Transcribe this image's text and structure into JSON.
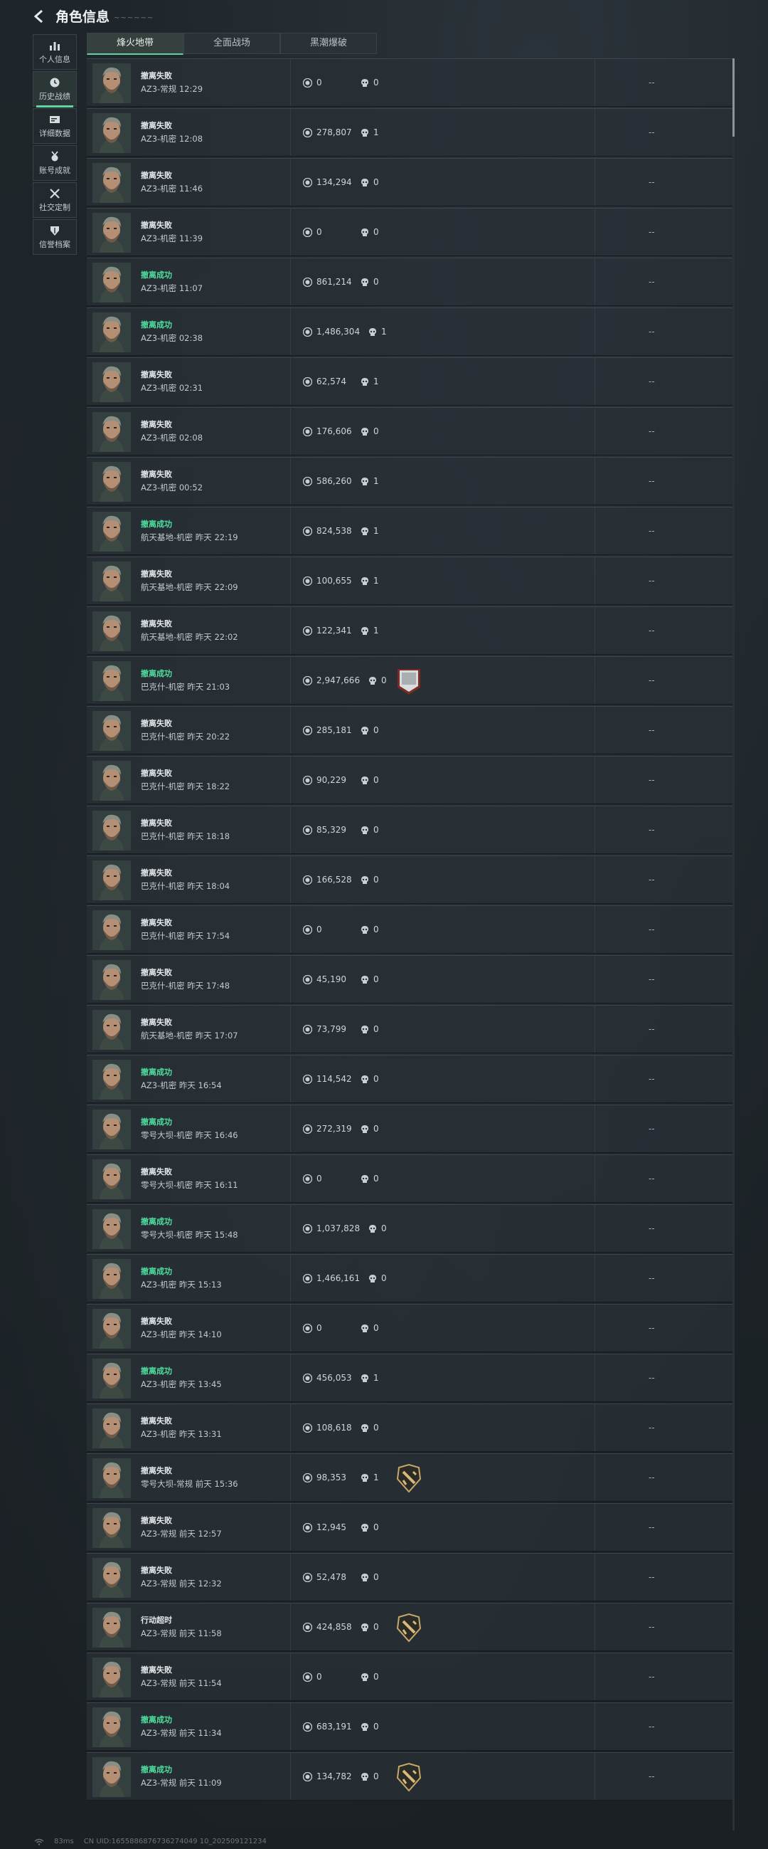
{
  "header": {
    "title": "角色信息",
    "title_deco": "~~~~~~"
  },
  "tabs": [
    {
      "label": "烽火地带",
      "active": true
    },
    {
      "label": "全面战场",
      "active": false
    },
    {
      "label": "黑潮爆破",
      "active": false
    }
  ],
  "sidebar": [
    {
      "label": "个人信息",
      "icon": "bar-chart-icon",
      "active": false,
      "name": "personal-info"
    },
    {
      "label": "历史战绩",
      "icon": "clock-icon",
      "active": true,
      "name": "history-record"
    },
    {
      "label": "详细数据",
      "icon": "data-card-icon",
      "active": false,
      "name": "detail-data"
    },
    {
      "label": "账号成就",
      "icon": "medal-icon",
      "active": false,
      "name": "achievements"
    },
    {
      "label": "社交定制",
      "icon": "tools-icon",
      "active": false,
      "name": "social-custom"
    },
    {
      "label": "信誉档案",
      "icon": "shield-icon",
      "active": false,
      "name": "credit-profile"
    }
  ],
  "colors": {
    "accent": "#5fd3a0",
    "success": "#4fe0a0",
    "row_bg": "#283036"
  },
  "matches": [
    {
      "status": "撤离失败",
      "ok": false,
      "map": "AZ3-常规 12:29",
      "value": "0",
      "kills": "0",
      "badge": "",
      "extra": "--"
    },
    {
      "status": "撤离失败",
      "ok": false,
      "map": "AZ3-机密 12:08",
      "value": "278,807",
      "kills": "1",
      "badge": "",
      "extra": "--"
    },
    {
      "status": "撤离失败",
      "ok": false,
      "map": "AZ3-机密 11:46",
      "value": "134,294",
      "kills": "0",
      "badge": "",
      "extra": "--"
    },
    {
      "status": "撤离失败",
      "ok": false,
      "map": "AZ3-机密 11:39",
      "value": "0",
      "kills": "0",
      "badge": "",
      "extra": "--"
    },
    {
      "status": "撤离成功",
      "ok": true,
      "map": "AZ3-机密 11:07",
      "value": "861,214",
      "kills": "0",
      "badge": "",
      "extra": "--"
    },
    {
      "status": "撤离成功",
      "ok": true,
      "map": "AZ3-机密 02:38",
      "value": "1,486,304",
      "kills": "1",
      "badge": "",
      "extra": "--"
    },
    {
      "status": "撤离失败",
      "ok": false,
      "map": "AZ3-机密 02:31",
      "value": "62,574",
      "kills": "1",
      "badge": "",
      "extra": "--"
    },
    {
      "status": "撤离失败",
      "ok": false,
      "map": "AZ3-机密 02:08",
      "value": "176,606",
      "kills": "0",
      "badge": "",
      "extra": "--"
    },
    {
      "status": "撤离失败",
      "ok": false,
      "map": "AZ3-机密 00:52",
      "value": "586,260",
      "kills": "1",
      "badge": "",
      "extra": "--"
    },
    {
      "status": "撤离成功",
      "ok": true,
      "map": "航天基地-机密 昨天 22:19",
      "value": "824,538",
      "kills": "1",
      "badge": "",
      "extra": "--"
    },
    {
      "status": "撤离失败",
      "ok": false,
      "map": "航天基地-机密 昨天 22:09",
      "value": "100,655",
      "kills": "1",
      "badge": "",
      "extra": "--"
    },
    {
      "status": "撤离失败",
      "ok": false,
      "map": "航天基地-机密 昨天 22:02",
      "value": "122,341",
      "kills": "1",
      "badge": "",
      "extra": "--"
    },
    {
      "status": "撤离成功",
      "ok": true,
      "map": "巴克什-机密 昨天 21:03",
      "value": "2,947,666",
      "kills": "0",
      "badge": "silver-rank-badge",
      "extra": "--"
    },
    {
      "status": "撤离失败",
      "ok": false,
      "map": "巴克什-机密 昨天 20:22",
      "value": "285,181",
      "kills": "0",
      "badge": "",
      "extra": "--"
    },
    {
      "status": "撤离失败",
      "ok": false,
      "map": "巴克什-机密 昨天 18:22",
      "value": "90,229",
      "kills": "0",
      "badge": "",
      "extra": "--"
    },
    {
      "status": "撤离失败",
      "ok": false,
      "map": "巴克什-机密 昨天 18:18",
      "value": "85,329",
      "kills": "0",
      "badge": "",
      "extra": "--"
    },
    {
      "status": "撤离失败",
      "ok": false,
      "map": "巴克什-机密 昨天 18:04",
      "value": "166,528",
      "kills": "0",
      "badge": "",
      "extra": "--"
    },
    {
      "status": "撤离失败",
      "ok": false,
      "map": "巴克什-机密 昨天 17:54",
      "value": "0",
      "kills": "0",
      "badge": "",
      "extra": "--"
    },
    {
      "status": "撤离失败",
      "ok": false,
      "map": "巴克什-机密 昨天 17:48",
      "value": "45,190",
      "kills": "0",
      "badge": "",
      "extra": "--"
    },
    {
      "status": "撤离失败",
      "ok": false,
      "map": "航天基地-机密 昨天 17:07",
      "value": "73,799",
      "kills": "0",
      "badge": "",
      "extra": "--"
    },
    {
      "status": "撤离成功",
      "ok": true,
      "map": "AZ3-机密 昨天 16:54",
      "value": "114,542",
      "kills": "0",
      "badge": "",
      "extra": "--"
    },
    {
      "status": "撤离成功",
      "ok": true,
      "map": "零号大坝-机密 昨天 16:46",
      "value": "272,319",
      "kills": "0",
      "badge": "",
      "extra": "--"
    },
    {
      "status": "撤离失败",
      "ok": false,
      "map": "零号大坝-机密 昨天 16:11",
      "value": "0",
      "kills": "0",
      "badge": "",
      "extra": "--"
    },
    {
      "status": "撤离成功",
      "ok": true,
      "map": "零号大坝-机密 昨天 15:48",
      "value": "1,037,828",
      "kills": "0",
      "badge": "",
      "extra": "--"
    },
    {
      "status": "撤离成功",
      "ok": true,
      "map": "AZ3-机密 昨天 15:13",
      "value": "1,466,161",
      "kills": "0",
      "badge": "",
      "extra": "--"
    },
    {
      "status": "撤离失败",
      "ok": false,
      "map": "AZ3-机密 昨天 14:10",
      "value": "0",
      "kills": "0",
      "badge": "",
      "extra": "--"
    },
    {
      "status": "撤离成功",
      "ok": true,
      "map": "AZ3-机密 昨天 13:45",
      "value": "456,053",
      "kills": "1",
      "badge": "",
      "extra": "--"
    },
    {
      "status": "撤离失败",
      "ok": false,
      "map": "AZ3-机密 昨天 13:31",
      "value": "108,618",
      "kills": "0",
      "badge": "",
      "extra": "--"
    },
    {
      "status": "撤离失败",
      "ok": false,
      "map": "零号大坝-常规 前天 15:36",
      "value": "98,353",
      "kills": "1",
      "badge": "gold-rifle-badge",
      "extra": "--"
    },
    {
      "status": "撤离失败",
      "ok": false,
      "map": "AZ3-常规 前天 12:57",
      "value": "12,945",
      "kills": "0",
      "badge": "",
      "extra": "--"
    },
    {
      "status": "撤离失败",
      "ok": false,
      "map": "AZ3-常规 前天 12:32",
      "value": "52,478",
      "kills": "0",
      "badge": "",
      "extra": "--"
    },
    {
      "status": "行动超时",
      "ok": false,
      "map": "AZ3-常规 前天 11:58",
      "value": "424,858",
      "kills": "0",
      "badge": "gold-rifle-badge",
      "extra": "--"
    },
    {
      "status": "撤离失败",
      "ok": false,
      "map": "AZ3-常规 前天 11:54",
      "value": "0",
      "kills": "0",
      "badge": "",
      "extra": "--"
    },
    {
      "status": "撤离成功",
      "ok": true,
      "map": "AZ3-常规 前天 11:34",
      "value": "683,191",
      "kills": "0",
      "badge": "",
      "extra": "--"
    },
    {
      "status": "撤离成功",
      "ok": true,
      "map": "AZ3-常规 前天 11:09",
      "value": "134,782",
      "kills": "0",
      "badge": "gold-rifle-badge",
      "extra": "--"
    }
  ],
  "footer": {
    "ping": "83ms",
    "uid": "CN UID:1655886876736274049 10_202509121234"
  }
}
